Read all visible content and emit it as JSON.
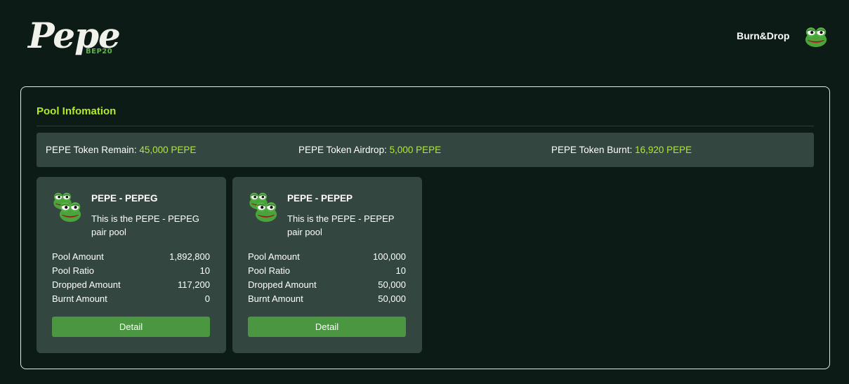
{
  "header": {
    "logo_text": "Pepe",
    "logo_subtext": "BEP20",
    "nav_link": "Burn&Drop"
  },
  "panel": {
    "title": "Pool Infomation",
    "stats": [
      {
        "label": "PEPE Token Remain:",
        "value": "45,000 PEPE"
      },
      {
        "label": "PEPE Token Airdrop:",
        "value": "5,000 PEPE"
      },
      {
        "label": "PEPE Token Burnt:",
        "value": "16,920 PEPE"
      }
    ]
  },
  "pools": [
    {
      "name": "PEPE - PEPEG",
      "description": "This is the PEPE - PEPEG pair pool",
      "rows": [
        {
          "label": "Pool Amount",
          "value": "1,892,800"
        },
        {
          "label": "Pool Ratio",
          "value": "10"
        },
        {
          "label": "Dropped Amount",
          "value": "117,200"
        },
        {
          "label": "Burnt Amount",
          "value": "0"
        }
      ],
      "button_label": "Detail"
    },
    {
      "name": "PEPE - PEPEP",
      "description": "This is the PEPE - PEPEP pair pool",
      "rows": [
        {
          "label": "Pool Amount",
          "value": "100,000"
        },
        {
          "label": "Pool Ratio",
          "value": "10"
        },
        {
          "label": "Dropped Amount",
          "value": "50,000"
        },
        {
          "label": "Burnt Amount",
          "value": "50,000"
        }
      ],
      "button_label": "Detail"
    }
  ],
  "icons": {
    "logo": "pepe-logo",
    "avatar": "pepe-frog-icon",
    "pool_icon": "pepe-pair-icon"
  },
  "colors": {
    "background": "#0c1b15",
    "accent": "#b0ec2a",
    "card": "#334640",
    "button": "#4b9641"
  }
}
